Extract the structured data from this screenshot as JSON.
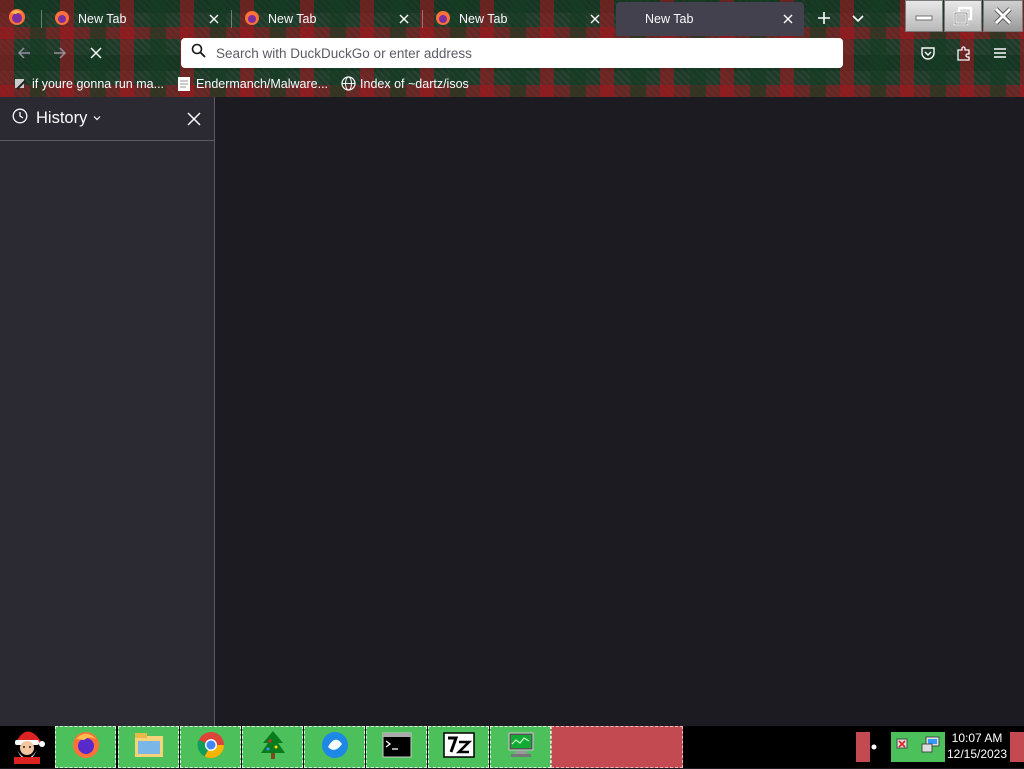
{
  "browser": {
    "tabs": [
      {
        "label": "New Tab",
        "active": false
      },
      {
        "label": "New Tab",
        "active": false
      },
      {
        "label": "New Tab",
        "active": false
      },
      {
        "label": "New Tab",
        "active": true
      }
    ],
    "url_placeholder": "Search with DuckDuckGo or enter address",
    "bookmarks": [
      {
        "label": "if youre gonna run ma...",
        "icon": "tool-icon"
      },
      {
        "label": "Endermanch/Malware...",
        "icon": "page-icon"
      },
      {
        "label": "Index of ~dartz/isos",
        "icon": "globe-icon"
      }
    ]
  },
  "sidebar": {
    "title": "History"
  },
  "taskbar": {
    "apps": [
      "firefox-icon",
      "file-explorer-icon",
      "chrome-icon",
      "christmas-tree-icon",
      "messenger-icon",
      "terminal-icon",
      "7zip-icon",
      "system-monitor-icon"
    ],
    "clock_time": "10:07 AM",
    "clock_date": "12/15/2023"
  },
  "colors": {
    "accent_green": "#4cc05a",
    "accent_red": "#c44a52",
    "sidebar_bg": "#2b2a33",
    "content_bg": "#1c1b22"
  }
}
